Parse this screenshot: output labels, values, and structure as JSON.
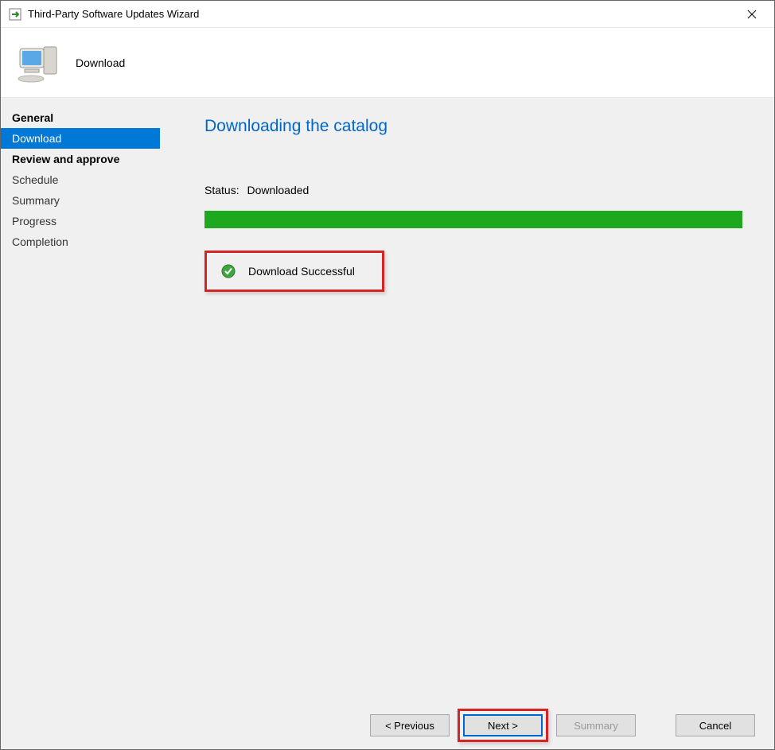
{
  "window": {
    "title": "Third-Party Software Updates Wizard"
  },
  "header": {
    "text": "Download"
  },
  "sidebar": {
    "items": [
      {
        "label": "General",
        "bold": true,
        "active": false
      },
      {
        "label": "Download",
        "bold": false,
        "active": true
      },
      {
        "label": "Review and approve",
        "bold": true,
        "active": false
      },
      {
        "label": "Schedule",
        "bold": false,
        "active": false
      },
      {
        "label": "Summary",
        "bold": false,
        "active": false
      },
      {
        "label": "Progress",
        "bold": false,
        "active": false
      },
      {
        "label": "Completion",
        "bold": false,
        "active": false
      }
    ]
  },
  "main": {
    "title": "Downloading the catalog",
    "status_label": "Status:",
    "status_value": "Downloaded",
    "progress_percent": 100,
    "result_message": "Download Successful"
  },
  "footer": {
    "previous": "< Previous",
    "next": "Next >",
    "summary": "Summary",
    "cancel": "Cancel"
  }
}
